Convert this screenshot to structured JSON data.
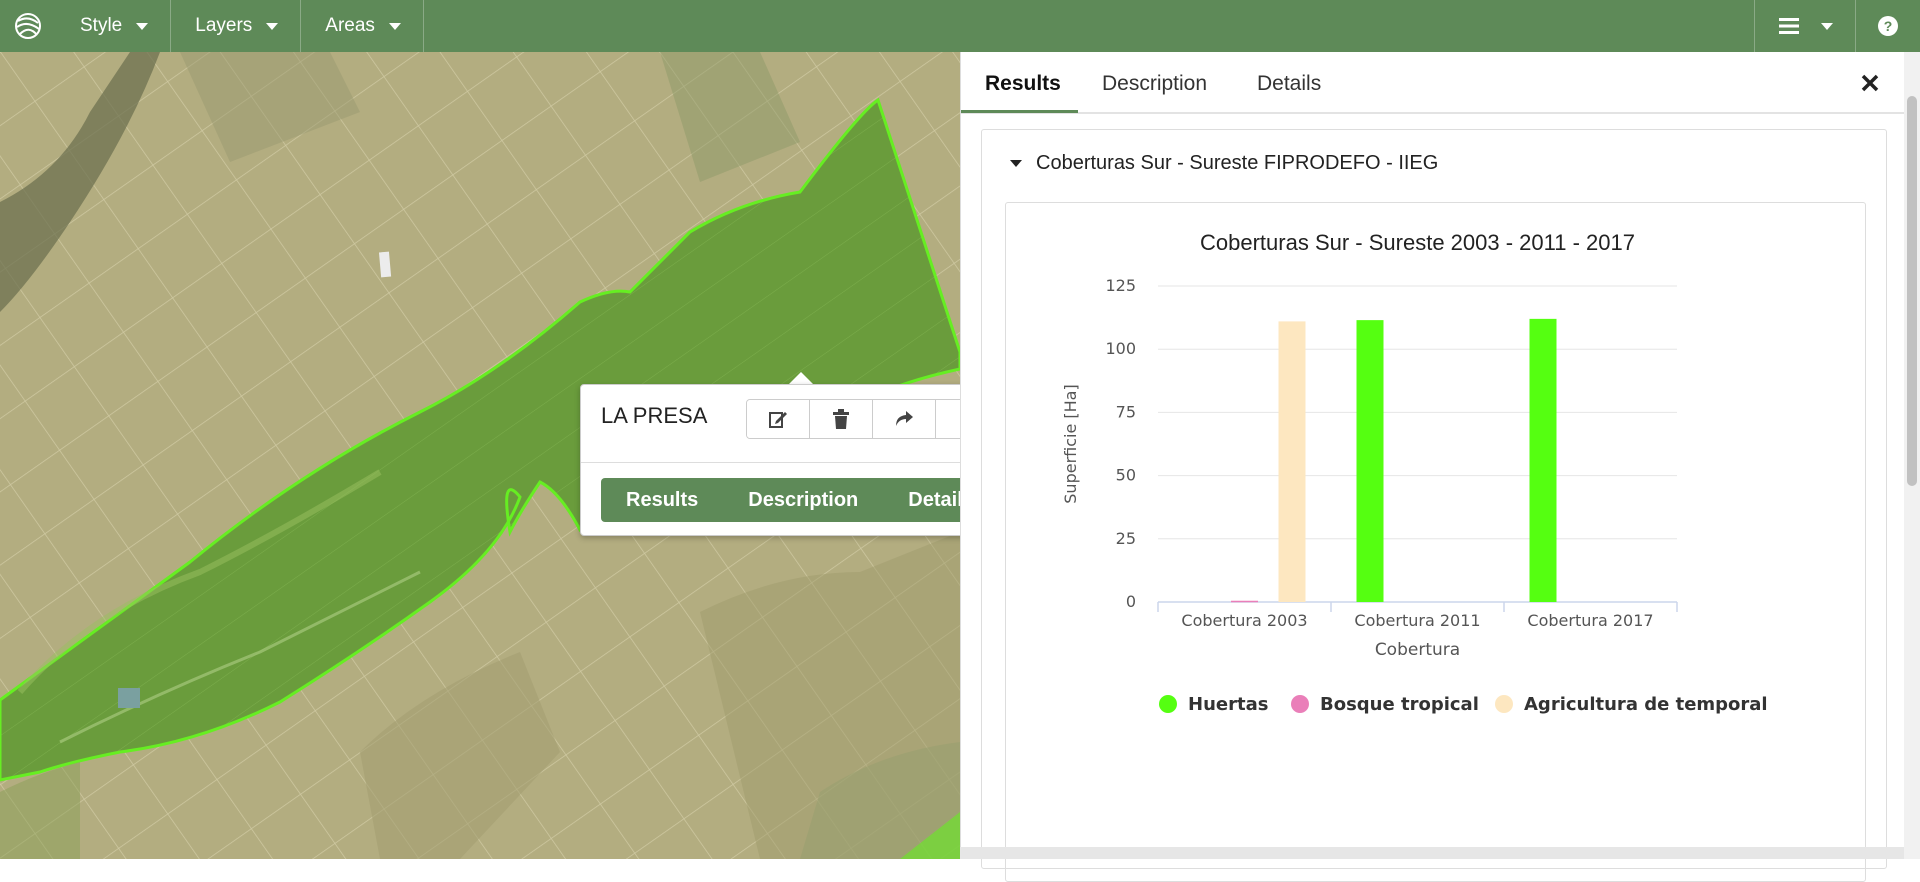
{
  "topbar": {
    "menus": [
      {
        "label": "Style"
      },
      {
        "label": "Layers"
      },
      {
        "label": "Areas"
      }
    ],
    "icons": [
      "app-logo-icon",
      "hamburger-icon",
      "help-icon"
    ]
  },
  "popup": {
    "title": "LA PRESA",
    "tabs": [
      "Results",
      "Description",
      "Details"
    ],
    "tools": [
      "edit-icon",
      "trash-icon",
      "share-icon"
    ]
  },
  "panel": {
    "tabs": [
      {
        "label": "Results"
      },
      {
        "label": "Description"
      },
      {
        "label": "Details"
      }
    ],
    "section_title": "Coberturas Sur - Sureste FIPRODEFO - IIEG"
  },
  "colors": {
    "brand_green": "#5e8a58",
    "huertas": "#55ff11",
    "bosque_tropical": "#ea7fb9",
    "agricultura_de_temporal": "#fde7c0"
  },
  "chart_data": {
    "type": "bar",
    "title": "Coberturas Sur - Sureste 2003 - 2011 - 2017",
    "xlabel": "Cobertura",
    "ylabel": "Superficie [Ha]",
    "categories": [
      "Cobertura 2003",
      "Cobertura 2011",
      "Cobertura 2017"
    ],
    "ylim": [
      0,
      125
    ],
    "yticks": [
      0,
      25,
      50,
      75,
      100,
      125
    ],
    "grid": true,
    "legend_position": "bottom",
    "series": [
      {
        "name": "Huertas",
        "color": "#55ff11",
        "values": [
          0,
          111.5,
          112
        ]
      },
      {
        "name": "Bosque tropical",
        "color": "#ea7fb9",
        "values": [
          0.5,
          0,
          0
        ]
      },
      {
        "name": "Agricultura de temporal",
        "color": "#fde7c0",
        "values": [
          111,
          0,
          0
        ]
      }
    ]
  }
}
